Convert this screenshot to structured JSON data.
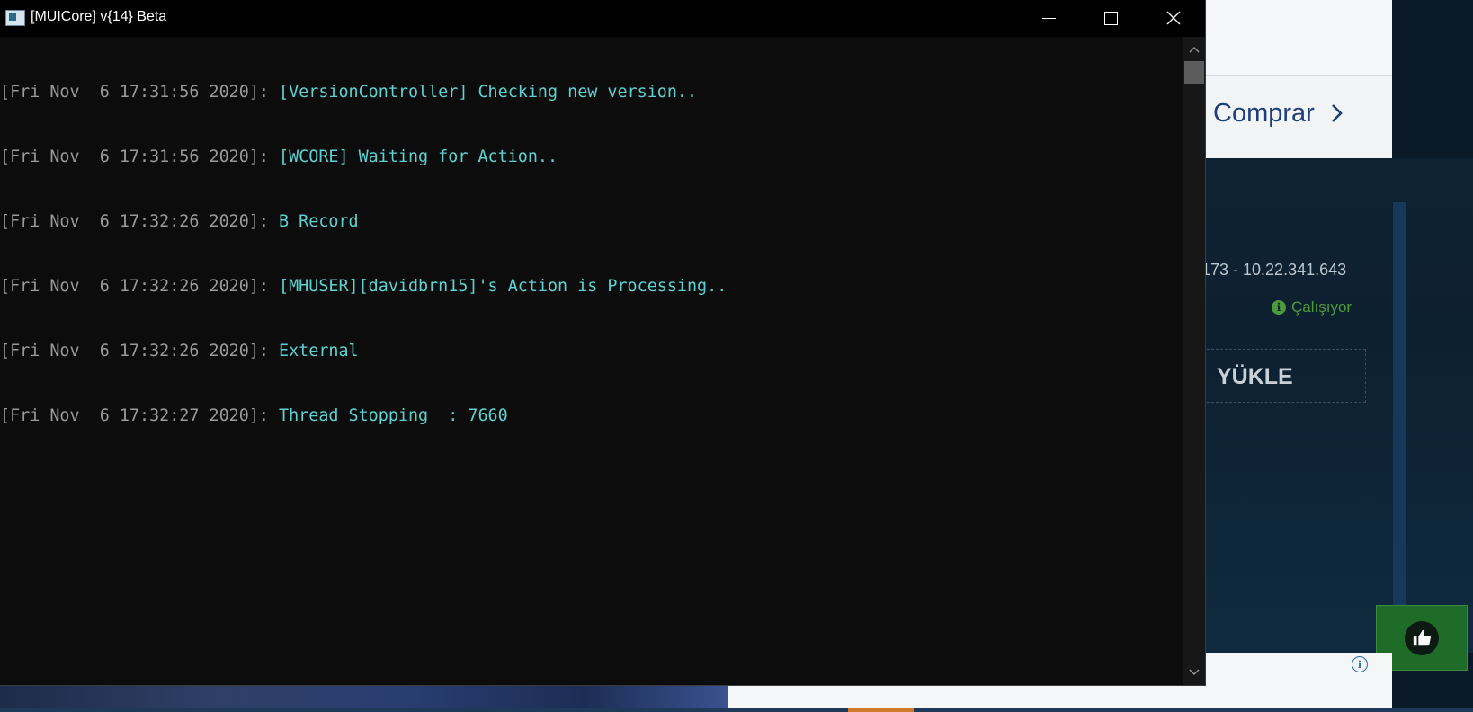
{
  "window": {
    "title": "[MUICore] v{14} Beta",
    "controls": {
      "minimize": "minimize",
      "maximize": "maximize",
      "close": "close"
    }
  },
  "console": {
    "lines": [
      {
        "timestamp": "[Fri Nov  6 17:31:56 2020]: ",
        "message": "[VersionController] Checking new version.."
      },
      {
        "timestamp": "[Fri Nov  6 17:31:56 2020]: ",
        "message": "[WCORE] Waiting for Action.."
      },
      {
        "timestamp": "[Fri Nov  6 17:32:26 2020]: ",
        "message": "B Record"
      },
      {
        "timestamp": "[Fri Nov  6 17:32:26 2020]: ",
        "message": "[MHUSER][davidbrn15]'s Action is Processing.."
      },
      {
        "timestamp": "[Fri Nov  6 17:32:26 2020]: ",
        "message": "External"
      },
      {
        "timestamp": "[Fri Nov  6 17:32:27 2020]: ",
        "message": "Thread Stopping  : 7660"
      }
    ]
  },
  "background_page": {
    "comprar_label": "Comprar",
    "ip_text": "173 - 10.22.341.643",
    "status_text": "Çalışıyor",
    "yukle_label": "YÜKLE",
    "like_button_icon": "thumbs-up-icon"
  },
  "colors": {
    "console_bg": "#0c0c0c",
    "timestamp": "#9a9a9a",
    "message": "#5ed2d2",
    "status_green": "#4c9a3a",
    "comprar_blue": "#1d3f7a"
  }
}
